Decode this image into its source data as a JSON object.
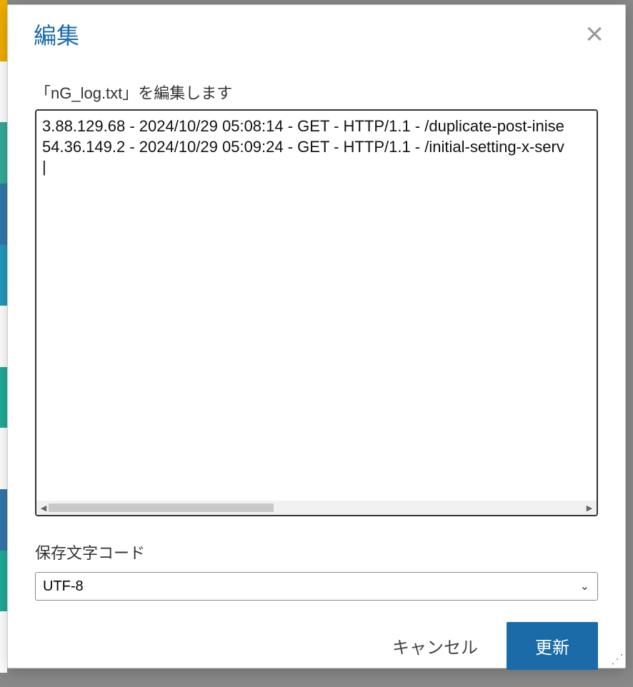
{
  "modal": {
    "title": "編集",
    "file_label": "「nG_log.txt」を編集します",
    "editor_content": "3.88.129.68 - 2024/10/29 05:08:14 - GET - HTTP/1.1 - /duplicate-post-inise\n54.36.149.2 - 2024/10/29 05:09:24 - GET - HTTP/1.1 - /initial-setting-x-serv\n|",
    "encoding_label": "保存文字コード",
    "encoding_value": "UTF-8",
    "encoding_options": [
      "UTF-8"
    ],
    "cancel_label": "キャンセル",
    "update_label": "更新"
  }
}
